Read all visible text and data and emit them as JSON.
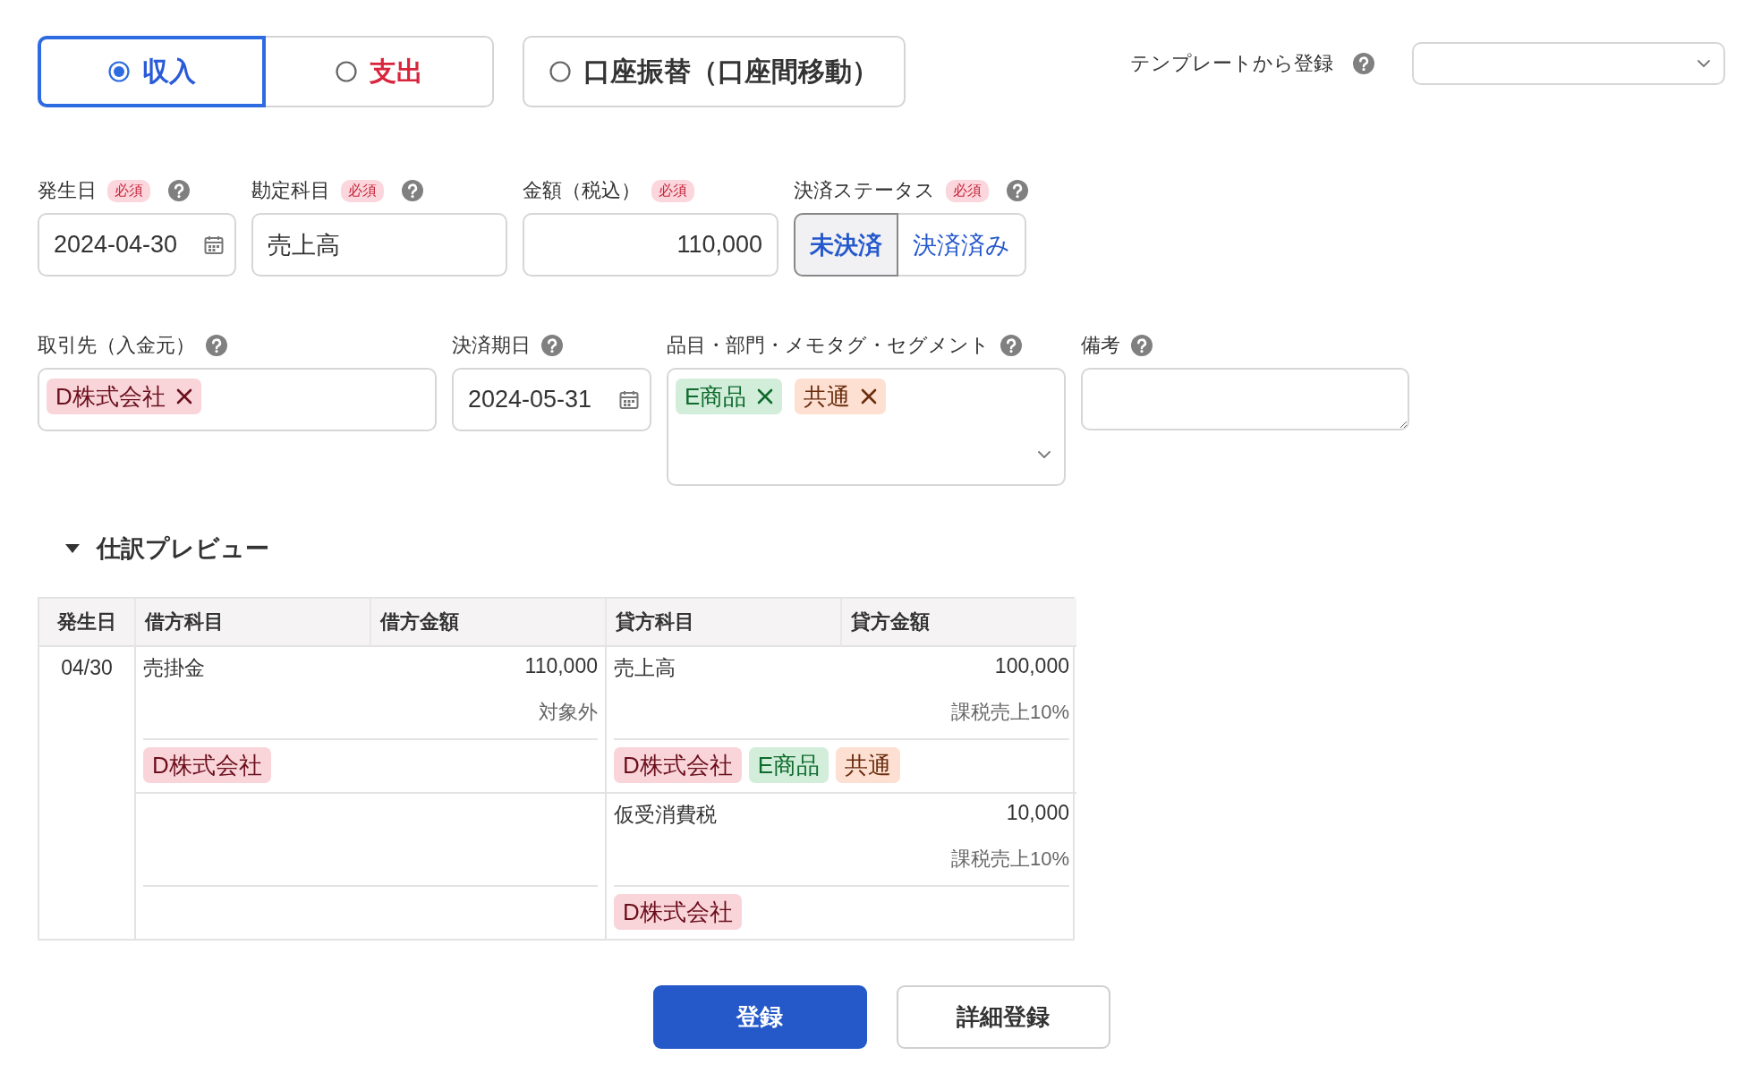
{
  "entry_types": [
    {
      "label": "収入",
      "kind": "income",
      "selected": true
    },
    {
      "label": "支出",
      "kind": "expense",
      "selected": false
    },
    {
      "label": "口座振替（口座間移動）",
      "kind": "transfer",
      "selected": false
    }
  ],
  "template": {
    "label": "テンプレートから登録",
    "help": true
  },
  "fields_row1": [
    {
      "kind": "date",
      "label": "発生日",
      "badge": "必須",
      "help": true,
      "value": "2024-04-30"
    },
    {
      "kind": "text",
      "label": "勘定科目",
      "badge": "必須",
      "help": true,
      "value": "売上高"
    },
    {
      "kind": "amount",
      "label": "金額（税込）",
      "badge": "必須",
      "help": false,
      "value": "110,000"
    },
    {
      "kind": "segmented",
      "label": "決済ステータス",
      "badge": "必須",
      "help": true,
      "options": [
        {
          "label": "未決済",
          "selected": true
        },
        {
          "label": "決済済み",
          "selected": false
        }
      ]
    }
  ],
  "fields_row2": [
    {
      "kind": "tags",
      "label": "取引先（入金元）",
      "help": true,
      "dropdown": false,
      "tags": [
        {
          "label": "D株式会社",
          "color": "#f9d5da",
          "removable": true
        }
      ]
    },
    {
      "kind": "date",
      "label": "決済期日",
      "help": true,
      "value": "2024-05-31"
    },
    {
      "kind": "tags",
      "label": "品目・部門・メモタグ・セグメント",
      "help": true,
      "dropdown": true,
      "tags": [
        {
          "label": "E商品",
          "color": "#d2eedb",
          "removable": true
        },
        {
          "label": "共通",
          "color": "#fde0d2",
          "removable": true
        }
      ]
    },
    {
      "kind": "textarea",
      "label": "備考",
      "help": true
    }
  ],
  "preview": {
    "title": "仕訳プレビュー",
    "expanded": true,
    "columns": [
      "発生日",
      "借方科目",
      "借方金額",
      "貸方科目",
      "貸方金額"
    ],
    "date": "04/30",
    "lines": [
      {
        "debit": {
          "account": "売掛金",
          "amount": "110,000",
          "tax": "対象外",
          "tags": [
            {
              "label": "D株式会社",
              "color": "#f9d5da"
            }
          ]
        },
        "credit": {
          "account": "売上高",
          "amount": "100,000",
          "tax": "課税売上10%",
          "tags": [
            {
              "label": "D株式会社",
              "color": "#f9d5da"
            },
            {
              "label": "E商品",
              "color": "#d2eedb"
            },
            {
              "label": "共通",
              "color": "#fde0d2"
            }
          ]
        }
      },
      {
        "credit": {
          "account": "仮受消費税",
          "amount": "10,000",
          "tax": "課税売上10%",
          "tags": [
            {
              "label": "D株式会社",
              "color": "#f9d5da"
            }
          ]
        }
      }
    ]
  },
  "buttons": [
    {
      "label": "登録",
      "kind": "primary"
    },
    {
      "label": "詳細登録",
      "kind": "secondary"
    }
  ]
}
